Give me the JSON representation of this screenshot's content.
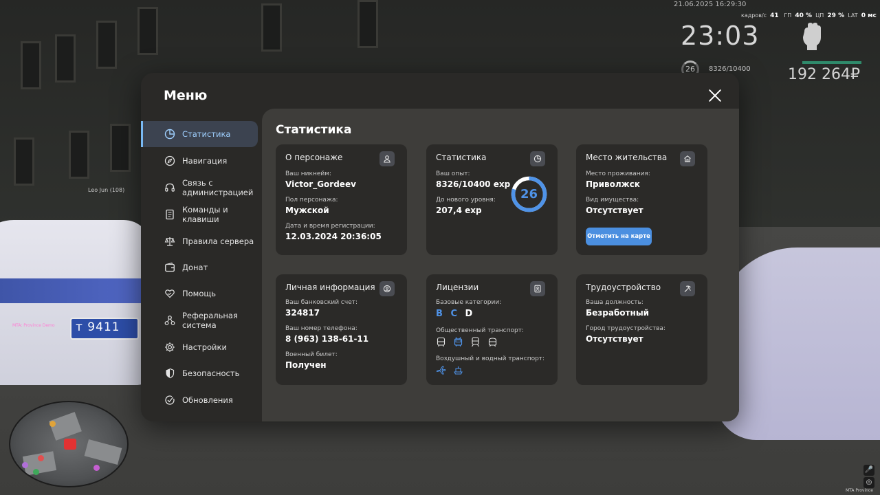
{
  "hud": {
    "datetime": "21.06.2025 16:29:30",
    "fps_label": "кадров/с",
    "fps_value": "41",
    "gpu_label": "ГП",
    "gpu_value": "40 %",
    "cpu_label": "ЦП",
    "cpu_value": "29 %",
    "lat_label": "LAT",
    "lat_value": "0 мс",
    "clock": "23:03",
    "level": "26",
    "exp": "8326/10400",
    "money": "192 264₽",
    "player_tag": "Leo Jun (108)",
    "car_tag": "MTA: Province Demo",
    "plate": "т 9411",
    "footer": "MTA Province"
  },
  "menu": {
    "title": "Меню",
    "sidebar": [
      {
        "id": "stats",
        "label": "Статистика",
        "icon": "pie-chart-icon",
        "active": true
      },
      {
        "id": "nav",
        "label": "Навигация",
        "icon": "compass-icon"
      },
      {
        "id": "admin",
        "label": "Связь с администрацией",
        "icon": "headset-icon"
      },
      {
        "id": "keys",
        "label": "Команды и клавиши",
        "icon": "document-icon"
      },
      {
        "id": "rules",
        "label": "Правила сервера",
        "icon": "scales-icon"
      },
      {
        "id": "donate",
        "label": "Донат",
        "icon": "wallet-icon"
      },
      {
        "id": "help",
        "label": "Помощь",
        "icon": "heart-hand-icon"
      },
      {
        "id": "referral",
        "label": "Реферальная система",
        "icon": "network-icon"
      },
      {
        "id": "settings",
        "label": "Настройки",
        "icon": "gear-icon"
      },
      {
        "id": "security",
        "label": "Безопасность",
        "icon": "shield-icon"
      },
      {
        "id": "updates",
        "label": "Обновления",
        "icon": "check-circle-icon"
      }
    ]
  },
  "content": {
    "title": "Статистика",
    "character": {
      "title": "О персонаже",
      "nickname_label": "Ваш никнейм:",
      "nickname": "Victor_Gordeev",
      "gender_label": "Пол персонажа:",
      "gender": "Мужской",
      "reg_label": "Дата и время регистрации:",
      "reg": "12.03.2024 20:36:05"
    },
    "stats": {
      "title": "Статистика",
      "exp_label": "Ваш опыт:",
      "exp": "8326/10400 exp",
      "next_label": "До нового уровня:",
      "next": "207,4 exp",
      "level": "26",
      "level_progress": 0.8
    },
    "residence": {
      "title": "Место жительства",
      "place_label": "Место проживания:",
      "place": "Приволжск",
      "property_label": "Вид имущества:",
      "property": "Отсутствует",
      "button": "Отметить на карте"
    },
    "personal": {
      "title": "Личная информация",
      "bank_label": "Ваш банковский счет:",
      "bank": "324817",
      "phone_label": "Ваш номер телефона:",
      "phone": "8 (963) 138-61-11",
      "military_label": "Военный билет:",
      "military": "Получен"
    },
    "licenses": {
      "title": "Лицензии",
      "base_label": "Базовые категории:",
      "categories": [
        {
          "label": "B",
          "active": true
        },
        {
          "label": "C",
          "active": true
        },
        {
          "label": "D",
          "active": false
        }
      ],
      "public_label": "Общественный транспорт:",
      "public_icons": [
        "bus-icon",
        "trolleybus-icon",
        "train-icon",
        "tram-icon"
      ],
      "public_active": [
        false,
        true,
        false,
        false
      ],
      "air_label": "Воздушный и водный транспорт:",
      "air_icons": [
        "plane-icon",
        "boat-icon"
      ]
    },
    "employment": {
      "title": "Трудоустройство",
      "position_label": "Ваша должность:",
      "position": "Безработный",
      "city_label": "Город трудоустройства:",
      "city": "Отсутствует"
    }
  },
  "colors": {
    "accent": "#4f93e8",
    "active_nav": "#9fd0ff",
    "active_nav_bar": "#79b9f4",
    "card_bg": "#2b2a28",
    "content_bg": "#3e3d3a",
    "modal_bg": "#2a2927"
  }
}
